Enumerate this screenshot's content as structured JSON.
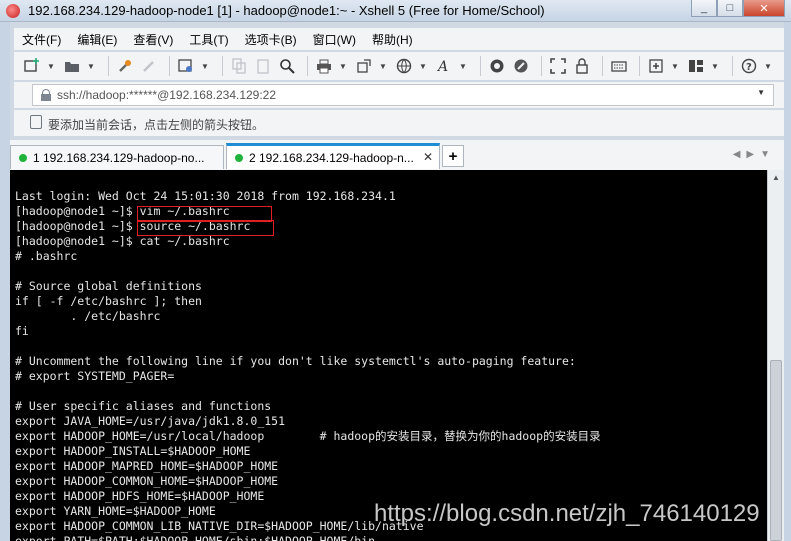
{
  "window": {
    "title": "192.168.234.129-hadoop-node1 [1] - hadoop@node1:~ - Xshell 5 (Free for Home/School)",
    "buttons": [
      "_",
      "□",
      "✕"
    ]
  },
  "menu": [
    "文件(F)",
    "编辑(E)",
    "查看(V)",
    "工具(T)",
    "选项卡(B)",
    "窗口(W)",
    "帮助(H)"
  ],
  "address": {
    "value": "ssh://hadoop:******@192.168.234.129:22"
  },
  "hint": {
    "text": "要添加当前会话，点击左侧的箭头按钮。"
  },
  "tabs": [
    {
      "label": "1 192.168.234.129-hadoop-no...",
      "active": false,
      "status_color": "#1fb33a"
    },
    {
      "label": "2 192.168.234.129-hadoop-n...",
      "active": true,
      "status_color": "#1fb33a"
    }
  ],
  "tab_add": "+",
  "terminal": {
    "lines": [
      "Last login: Wed Oct 24 15:01:30 2018 from 192.168.234.1",
      "[hadoop@node1 ~]$ vim ~/.bashrc",
      "[hadoop@node1 ~]$ source ~/.bashrc",
      "[hadoop@node1 ~]$ cat ~/.bashrc",
      "# .bashrc",
      "",
      "# Source global definitions",
      "if [ -f /etc/bashrc ]; then",
      "        . /etc/bashrc",
      "fi",
      "",
      "# Uncomment the following line if you don't like systemctl's auto-paging feature:",
      "# export SYSTEMD_PAGER=",
      "",
      "# User specific aliases and functions",
      "export JAVA_HOME=/usr/java/jdk1.8.0_151",
      "export HADOOP_HOME=/usr/local/hadoop        # hadoop的安装目录，替换为你的hadoop的安装目录",
      "export HADOOP_INSTALL=$HADOOP_HOME",
      "export HADOOP_MAPRED_HOME=$HADOOP_HOME",
      "export HADOOP_COMMON_HOME=$HADOOP_HOME",
      "export HADOOP_HDFS_HOME=$HADOOP_HOME",
      "export YARN_HOME=$HADOOP_HOME",
      "export HADOOP_COMMON_LIB_NATIVE_DIR=$HADOOP_HOME/lib/native",
      "export PATH=$PATH:$HADOOP_HOME/sbin:$HADOOP_HOME/bin"
    ]
  },
  "watermark": "https://blog.csdn.net/zjh_746140129",
  "colors": {
    "terminal_bg": "#000000",
    "terminal_fg": "#e6e6e6",
    "highlight_box": "#e02020",
    "active_tab_accent": "#1f8dd6"
  },
  "toolbar_icons": [
    "new-session-icon",
    "open-folder-icon",
    "reconnect-icon",
    "disconnect-icon",
    "properties-icon",
    "copy-icon",
    "paste-icon",
    "find-icon",
    "print-icon",
    "transfer-icon",
    "globe-icon",
    "font-icon",
    "xftp-icon",
    "xmanager-icon",
    "fullscreen-icon",
    "lock-icon",
    "keyboard-icon",
    "add-icon",
    "layout-icon",
    "help-icon"
  ]
}
